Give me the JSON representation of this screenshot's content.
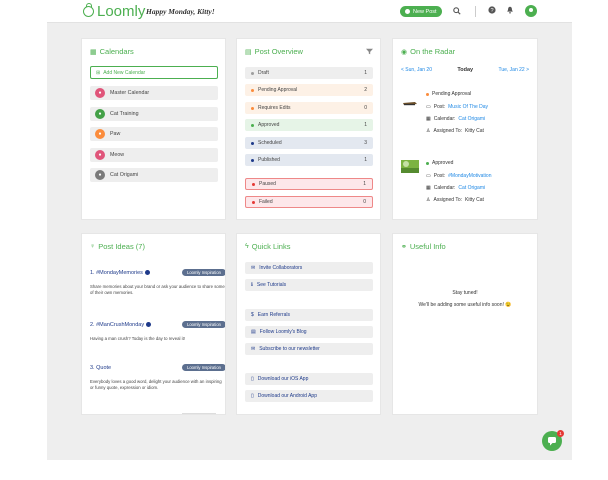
{
  "header": {
    "brand": "Loomly",
    "greeting": "Happy Monday, Kitty!",
    "new_post_label": "New Post",
    "icons": [
      "search-icon",
      "help-icon",
      "bell-icon",
      "user-icon"
    ],
    "accent": "#4caf50"
  },
  "calendars": {
    "title": "Calendars",
    "add_label": "Add New Calendar",
    "items": [
      {
        "label": "Master Calendar",
        "color": "#e0557a"
      },
      {
        "label": "Cat Training",
        "color": "#43a047"
      },
      {
        "label": "Paw",
        "color": "#fb8c3c"
      },
      {
        "label": "Meow",
        "color": "#e0557a"
      },
      {
        "label": "Cat Origami",
        "color": "#7a7a7a"
      }
    ]
  },
  "post_overview": {
    "title": "Post Overview",
    "rows": [
      {
        "label": "Draft",
        "count": "1",
        "bg": "#eeeeee",
        "dot": "#9e9e9e",
        "border": ""
      },
      {
        "label": "Pending Approval",
        "count": "2",
        "bg": "#fdf1e6",
        "dot": "#fb8c3c",
        "border": ""
      },
      {
        "label": "Requires Edits",
        "count": "0",
        "bg": "#fdf1e6",
        "dot": "#fb8c3c",
        "border": ""
      },
      {
        "label": "Approved",
        "count": "1",
        "bg": "#e6f4e7",
        "dot": "#4caf50",
        "border": ""
      },
      {
        "label": "Scheduled",
        "count": "3",
        "bg": "#e3e8f0",
        "dot": "#1e3a8a",
        "border": ""
      },
      {
        "label": "Published",
        "count": "1",
        "bg": "#e3e8f0",
        "dot": "#1e3a8a",
        "border": ""
      },
      {
        "label": "Paused",
        "count": "1",
        "bg": "#fde7ea",
        "dot": "#e53935",
        "border": "#e88"
      },
      {
        "label": "Failed",
        "count": "0",
        "bg": "#fde7ea",
        "dot": "#e53935",
        "border": "#e88"
      }
    ]
  },
  "radar": {
    "title": "On the Radar",
    "prev": "< Sun, Jan 20",
    "today": "Today",
    "next": "Tue, Jan 22 >",
    "entries": [
      {
        "status": "Pending Approval",
        "status_color": "#fb8c3c",
        "post_label": "Post:",
        "post": "Music Of The Day",
        "calendar_label": "Calendar:",
        "calendar": "Cat Origami",
        "assigned_label": "Assigned To:",
        "assigned": "Kitty Cat"
      },
      {
        "status": "Approved",
        "status_color": "#4caf50",
        "post_label": "Post:",
        "post": "#MondayMotivation",
        "calendar_label": "Calendar:",
        "calendar": "Cat Origami",
        "assigned_label": "Assigned To:",
        "assigned": "Kitty Cat"
      }
    ]
  },
  "post_ideas": {
    "title": "Post Ideas (7)",
    "items": [
      {
        "title": "1. #MondayMemories",
        "badge": "Loomly Inspiration",
        "desc": "Share memories about your brand or ask your audience to share some of their own memories."
      },
      {
        "title": "2. #ManCrushMonday",
        "badge": "Loomly Inspiration",
        "desc": "Having a man crush? Today is the day to reveal it!"
      },
      {
        "title": "3. Quote",
        "badge": "Loomly Inspiration",
        "desc": "Everybody loves a good word, delight your audience with an inspiring or funny quote, expression or idiom."
      }
    ]
  },
  "quick_links": {
    "title": "Quick Links",
    "items": [
      {
        "label": "Invite Collaborators",
        "icon": "mail-icon"
      },
      {
        "label": "See Tutorials",
        "icon": "info-icon"
      },
      {
        "label": "Earn Referrals",
        "icon": "dollar-icon"
      },
      {
        "label": "Follow Loomly's Blog",
        "icon": "newspaper-icon"
      },
      {
        "label": "Subscribe to our newsletter",
        "icon": "envelope-icon"
      },
      {
        "label": "Download our iOS App",
        "icon": "phone-icon"
      },
      {
        "label": "Download our Android App",
        "icon": "phone-icon"
      }
    ]
  },
  "useful_info": {
    "title": "Useful Info",
    "line1": "Stay tuned!",
    "line2": "We'll be adding some useful info soon! 😉"
  },
  "chat": {
    "badge": "1"
  }
}
